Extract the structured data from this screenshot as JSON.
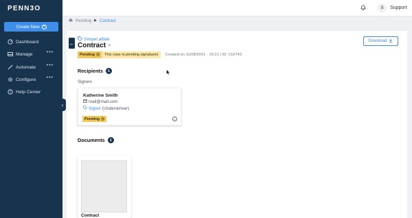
{
  "app": {
    "logo": "PENN3O"
  },
  "sidebar": {
    "create_label": "Create New",
    "items": [
      {
        "label": "Dashboard",
        "icon": "dashboard-icon",
        "dots": ""
      },
      {
        "label": "Manage",
        "icon": "inbox-icon",
        "dots": "•••"
      },
      {
        "label": "Automate",
        "icon": "magic-icon",
        "dots": "•••"
      },
      {
        "label": "Configure",
        "icon": "gear-icon",
        "dots": "•••"
      },
      {
        "label": "Help Center",
        "icon": "help-icon",
        "dots": ""
      }
    ]
  },
  "topbar": {
    "avatar_initial": "S",
    "user": "Support"
  },
  "breadcrumb": {
    "home": "Pending",
    "current": "Contract"
  },
  "case": {
    "folder": "Simpel.aftale",
    "title": "Contract",
    "status": "Pending",
    "status_message": "This case is pending signatures",
    "created": "Created on 11/08/2021 - 16:21 | ID: 210743",
    "download_label": "Download"
  },
  "recipients": {
    "heading": "Recipients",
    "count": "1",
    "signers_label": "Signers",
    "signer": {
      "name": "Katherine Smith",
      "email": "mail@mail.com",
      "role": "Signer",
      "role_note": "(Underskriver)",
      "status": "Pending"
    }
  },
  "documents": {
    "heading": "Documents",
    "count": "1",
    "items": [
      {
        "name": "Contract"
      }
    ]
  },
  "colors": {
    "sidebar": "#18334d",
    "accent": "#3b8ae0",
    "pending": "#f3c85a",
    "pending_light": "#fbe7a7"
  }
}
